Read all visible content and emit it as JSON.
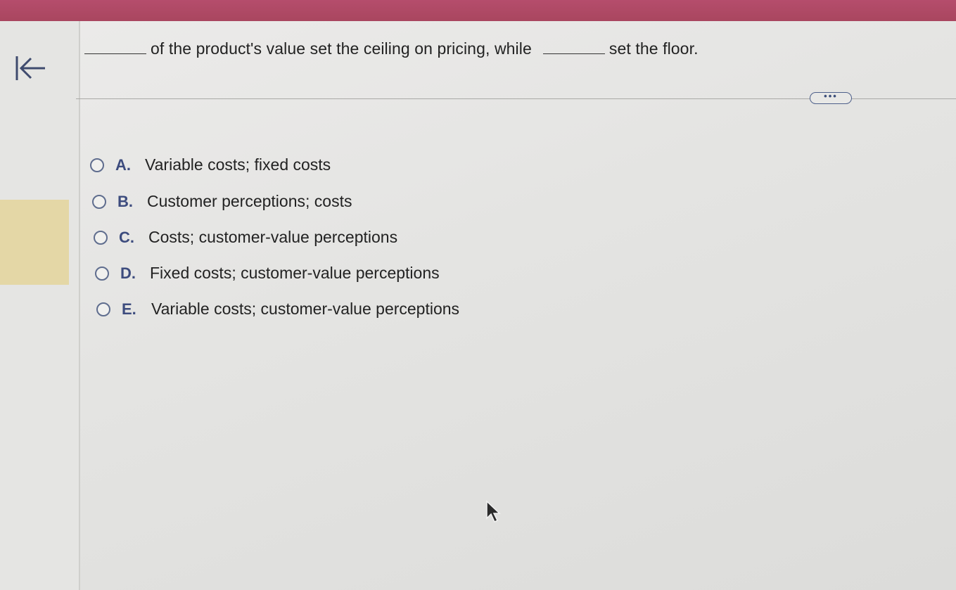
{
  "question": {
    "part1": "of the product's value set the ceiling on pricing, while",
    "part2": "set the floor."
  },
  "more_button": {
    "label": "•••"
  },
  "options": [
    {
      "letter": "A.",
      "text": "Variable costs; fixed costs"
    },
    {
      "letter": "B.",
      "text": "Customer perceptions; costs"
    },
    {
      "letter": "C.",
      "text": "Costs; customer-value perceptions"
    },
    {
      "letter": "D.",
      "text": "Fixed costs; customer-value perceptions"
    },
    {
      "letter": "E.",
      "text": "Variable costs; customer-value perceptions"
    }
  ],
  "icons": {
    "back": "back-to-start-icon",
    "cursor": "mouse-pointer-icon"
  },
  "colors": {
    "top_bar": "#a9465f",
    "accent": "#3d4c7e",
    "highlight": "#e4d7a6"
  }
}
